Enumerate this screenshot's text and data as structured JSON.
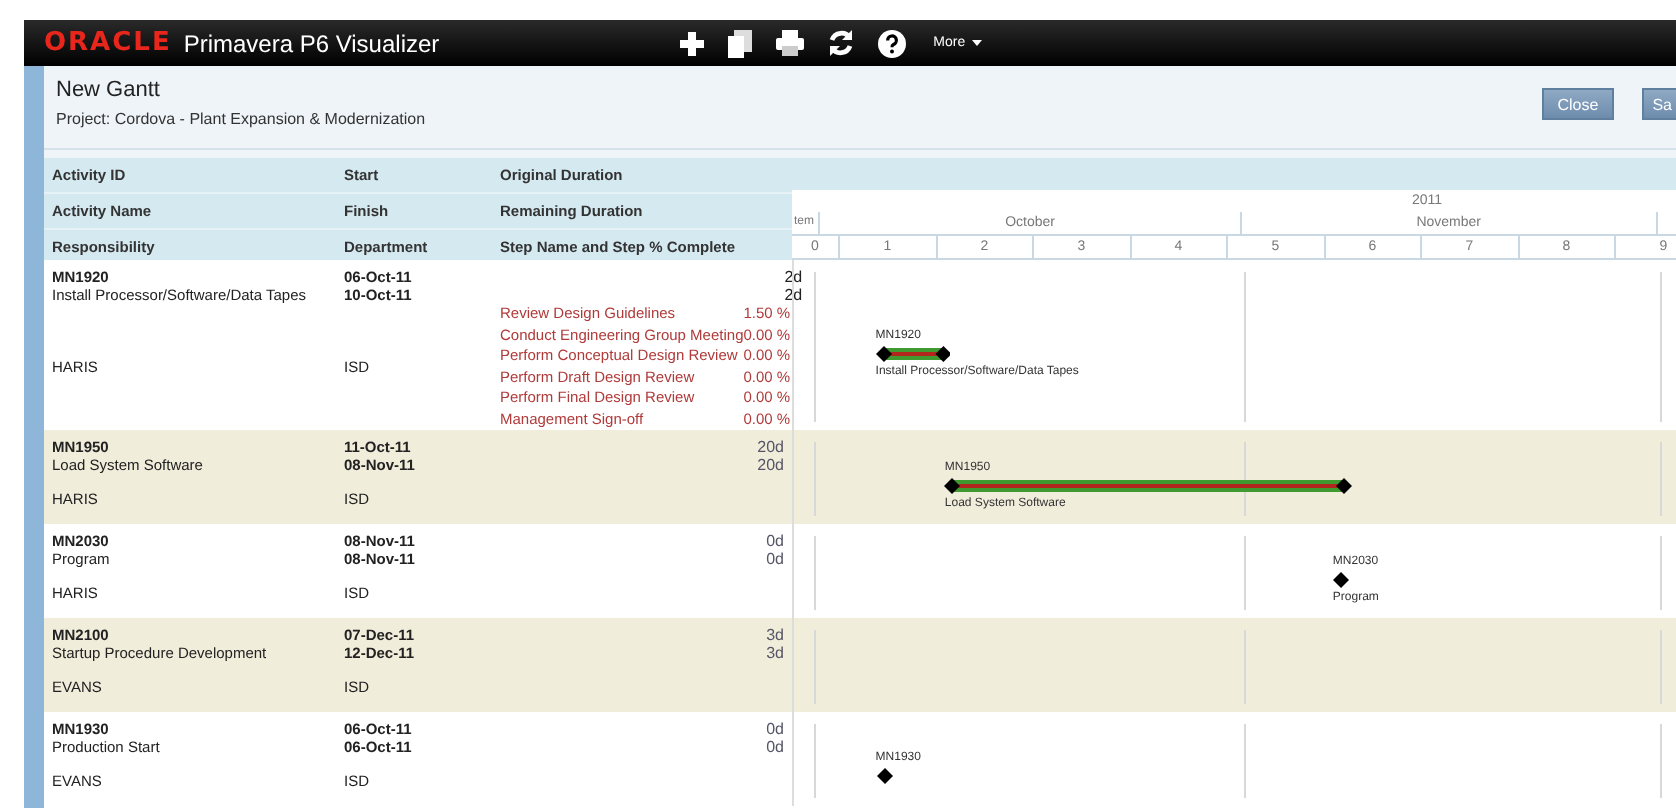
{
  "app": {
    "logo": "ORACLE",
    "title": "Primavera P6 Visualizer",
    "menu": "More"
  },
  "view": {
    "title": "New Gantt",
    "project": "Project: Cordova - Plant Expansion & Modernization"
  },
  "buttons": [
    "Close",
    "Sa"
  ],
  "header_rows": [
    [
      "Activity ID",
      "Start",
      "Original Duration"
    ],
    [
      "Activity Name",
      "Finish",
      "Remaining Duration"
    ],
    [
      "Responsibility",
      "Department",
      "Step Name and Step % Complete"
    ]
  ],
  "timescale": {
    "year": "2011",
    "months": [
      "tem",
      "October",
      "November"
    ],
    "weeks": [
      "0",
      "1",
      "2",
      "3",
      "4",
      "5",
      "6",
      "7",
      "8",
      "9"
    ]
  },
  "activities": [
    {
      "id": "MN1920",
      "name": "Install Processor/Software/Data Tapes",
      "responsibility": "HARIS",
      "start": "06-Oct-11",
      "finish": "10-Oct-11",
      "department": "ISD",
      "original_duration": "2d",
      "remaining_duration": "2d",
      "steps": [
        {
          "name": "Review Design Guidelines",
          "percent": "1.50 %"
        },
        {
          "name": "Conduct Engineering Group Meeting",
          "percent": "0.00 %"
        },
        {
          "name": "Perform Conceptual Design Review",
          "percent": "0.00 %"
        },
        {
          "name": "Perform Draft Design Review",
          "percent": "0.00 %"
        },
        {
          "name": "Perform Final Design Review",
          "percent": "0.00 %"
        },
        {
          "name": "Management Sign-off",
          "percent": "0.00 %"
        }
      ],
      "bar": {
        "kind": "task",
        "label": "MN1920",
        "caption": "Install Processor/Software/Data Tapes"
      }
    },
    {
      "id": "MN1950",
      "name": "Load System Software",
      "responsibility": "HARIS",
      "start": "11-Oct-11",
      "finish": "08-Nov-11",
      "department": "ISD",
      "original_duration": "20d",
      "remaining_duration": "20d",
      "bar": {
        "kind": "task",
        "label": "MN1950",
        "caption": "Load System Software"
      }
    },
    {
      "id": "MN2030",
      "name": "Program",
      "responsibility": "HARIS",
      "start": "08-Nov-11",
      "finish": "08-Nov-11",
      "department": "ISD",
      "original_duration": "0d",
      "remaining_duration": "0d",
      "bar": {
        "kind": "milestone",
        "label": "MN2030",
        "caption": "Program"
      }
    },
    {
      "id": "MN2100",
      "name": "Startup Procedure Development",
      "responsibility": "EVANS",
      "start": "07-Dec-11",
      "finish": "12-Dec-11",
      "department": "ISD",
      "original_duration": "3d",
      "remaining_duration": "3d"
    },
    {
      "id": "MN1930",
      "name": "Production Start",
      "responsibility": "EVANS",
      "start": "06-Oct-11",
      "finish": "06-Oct-11",
      "department": "ISD",
      "original_duration": "0d",
      "remaining_duration": "0d",
      "bar": {
        "kind": "milestone",
        "label": "MN1930"
      }
    }
  ]
}
